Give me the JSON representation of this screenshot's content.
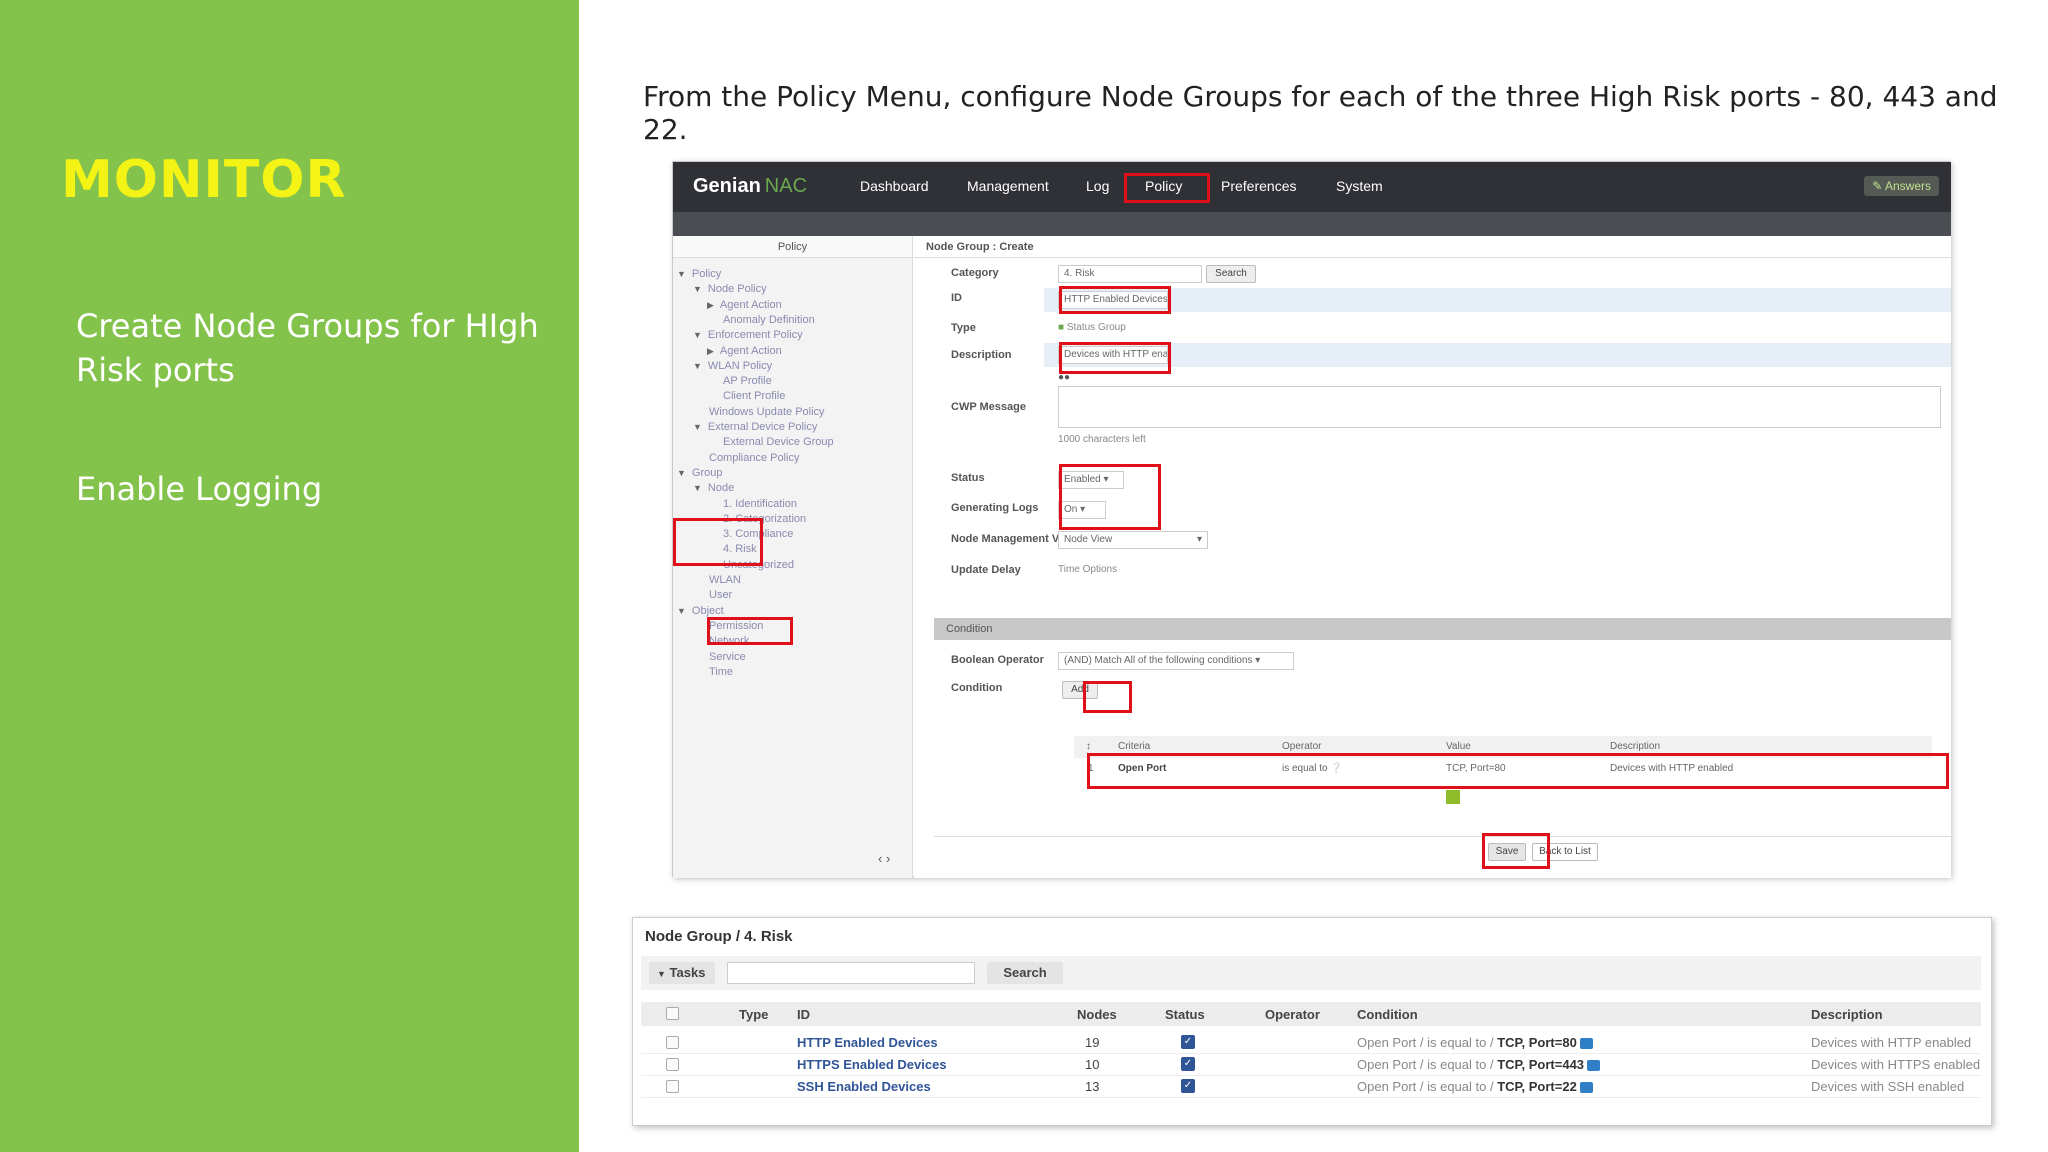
{
  "left_panel": {
    "title": "MONITOR",
    "items": [
      "Create Node Groups for HIgh Risk ports",
      "Enable Logging"
    ],
    "bg_color": "#83c24b",
    "title_color": "#f3f315"
  },
  "instruction": "From the Policy Menu, configure Node Groups for each of the three High Risk ports - 80, 443 and 22.",
  "screenshot1": {
    "brand": "Genian",
    "brand_suffix": "NAC",
    "nav": [
      "Dashboard",
      "Management",
      "Log",
      "Policy",
      "Preferences",
      "System"
    ],
    "answers": "Answers",
    "sidebar_header": "Policy",
    "tree": [
      {
        "label": "Policy",
        "arrow": "▼"
      },
      {
        "label": "Node Policy",
        "arrow": "▼"
      },
      {
        "label": "Agent Action",
        "arrow": "▶"
      },
      {
        "label": "Anomaly Definition",
        "arrow": ""
      },
      {
        "label": "Enforcement Policy",
        "arrow": "▼"
      },
      {
        "label": "Agent Action",
        "arrow": "▶"
      },
      {
        "label": "WLAN Policy",
        "arrow": "▼"
      },
      {
        "label": "AP Profile",
        "arrow": ""
      },
      {
        "label": "Client Profile",
        "arrow": ""
      },
      {
        "label": "Windows Update Policy",
        "arrow": ""
      },
      {
        "label": "External Device Policy",
        "arrow": "▼"
      },
      {
        "label": "External Device Group",
        "arrow": ""
      },
      {
        "label": "Compliance Policy",
        "arrow": ""
      },
      {
        "label": "Group",
        "arrow": "▼"
      },
      {
        "label": "Node",
        "arrow": "▼"
      },
      {
        "label": "1. Identification",
        "arrow": ""
      },
      {
        "label": "2. Categorization",
        "arrow": ""
      },
      {
        "label": "3. Compliance",
        "arrow": ""
      },
      {
        "label": "4. Risk",
        "arrow": ""
      },
      {
        "label": "Uncategorized",
        "arrow": ""
      },
      {
        "label": "WLAN",
        "arrow": ""
      },
      {
        "label": "User",
        "arrow": ""
      },
      {
        "label": "Object",
        "arrow": "▼"
      },
      {
        "label": "Permission",
        "arrow": ""
      },
      {
        "label": "Network",
        "arrow": ""
      },
      {
        "label": "Service",
        "arrow": ""
      },
      {
        "label": "Time",
        "arrow": ""
      }
    ],
    "content_header": "Node Group : Create",
    "form": {
      "category_label": "Category",
      "category_value": "4. Risk",
      "search_btn": "Search",
      "id_label": "ID",
      "id_value": "HTTP Enabled Devices",
      "type_label": "Type",
      "type_value": "Status Group",
      "description_label": "Description",
      "description_value": "Devices with HTTP enabled",
      "cwp_label": "CWP Message",
      "cwp_hint": "1000 characters left",
      "status_label": "Status",
      "status_value": "Enabled",
      "logs_label": "Generating Logs",
      "logs_value": "On",
      "view_label": "Node Management View",
      "view_value": "Node View",
      "delay_label": "Update Delay",
      "delay_value": "Time Options"
    },
    "condition": {
      "section": "Condition",
      "bool_label": "Boolean Operator",
      "bool_value": "(AND) Match All of the following conditions",
      "cond_label": "Condition",
      "add_btn": "Add",
      "headers": [
        "Criteria",
        "Operator",
        "Value",
        "Description"
      ],
      "row": {
        "criteria": "Open Port",
        "operator": "is equal to",
        "value": "TCP, Port=80",
        "description": "Devices with HTTP enabled"
      }
    },
    "save_btn": "Save",
    "back_btn": "Back to List",
    "highlight_color": "#e0101a"
  },
  "screenshot2": {
    "breadcrumb": "Node Group / 4. Risk",
    "tasks": "Tasks",
    "search_btn": "Search",
    "headers": [
      "Type",
      "ID",
      "Nodes",
      "Status",
      "Operator",
      "Condition",
      "Description"
    ],
    "rows": [
      {
        "id": "HTTP Enabled Devices",
        "nodes": "19",
        "cond_prefix": "Open Port / is equal to / ",
        "cond_value": "TCP, Port=80",
        "description": "Devices with HTTP enabled"
      },
      {
        "id": "HTTPS Enabled Devices",
        "nodes": "10",
        "cond_prefix": "Open Port / is equal to / ",
        "cond_value": "TCP, Port=443",
        "description": "Devices with HTTPS enabled"
      },
      {
        "id": "SSH Enabled Devices",
        "nodes": "13",
        "cond_prefix": "Open Port / is equal to / ",
        "cond_value": "TCP, Port=22",
        "description": "Devices with SSH enabled"
      }
    ]
  }
}
